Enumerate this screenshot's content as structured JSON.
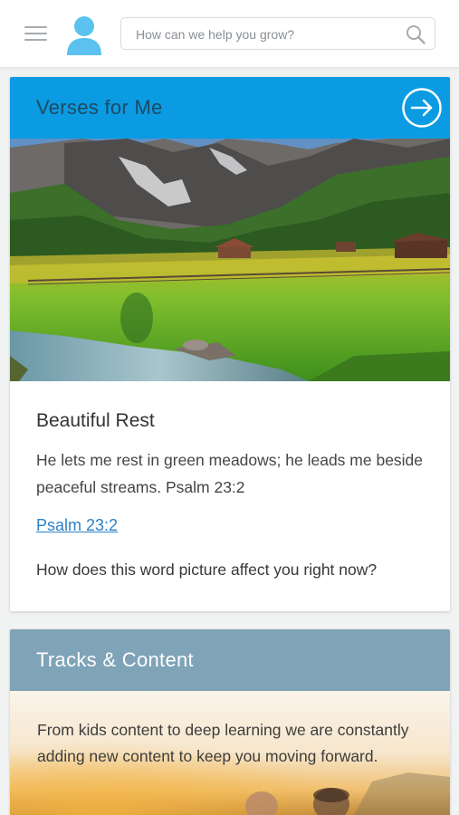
{
  "header": {
    "search": {
      "placeholder": "How can we help you grow?",
      "value": ""
    },
    "menu_icon": "hamburger-menu-icon",
    "avatar_icon": "user-avatar-icon",
    "search_icon": "magnifier-icon"
  },
  "verses_card": {
    "title": "Verses for Me",
    "header_color": "#0b9be2",
    "arrow_icon": "circle-arrow-right-icon",
    "image": "mountain-meadow-stream-photo",
    "verse_title": "Beautiful Rest",
    "verse_text": "He lets me rest in green meadows; he leads me beside peaceful streams. Psalm 23:2",
    "link_label": "Psalm 23:2",
    "question": "How does this word picture affect you right now?"
  },
  "tracks_card": {
    "title": "Tracks & Content",
    "header_color": "#7fa3b7",
    "description": "From kids content to deep learning we are constantly adding new content to keep you moving forward."
  }
}
